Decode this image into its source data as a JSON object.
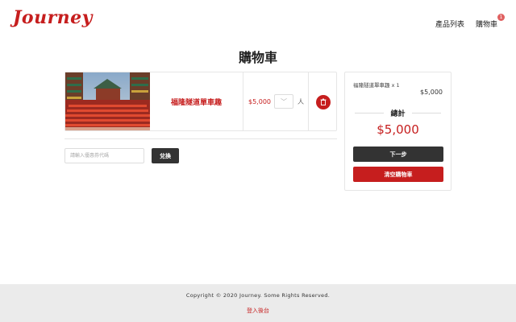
{
  "header": {
    "logo": "Journey",
    "nav": {
      "products": "產品列表",
      "cart": "購物車"
    },
    "cart_badge": "1"
  },
  "page": {
    "title": "購物車"
  },
  "cart_item": {
    "name": "福隆隧道單車趣",
    "price": "$5,000",
    "unit": "人"
  },
  "coupon": {
    "placeholder": "請輸入優惠券代碼",
    "apply_label": "兌換"
  },
  "summary": {
    "line_item": "福隆隧道單車趣 x 1",
    "line_price": "$5,000",
    "total_label": "總計",
    "total_value": "$5,000",
    "next_label": "下一步",
    "clear_label": "清空購物車"
  },
  "footer": {
    "copyright": "Copyright © 2020 Journey. Some Rights Reserved.",
    "admin_link": "登入後台"
  },
  "colors": {
    "brand": "#c61e1e",
    "dark_button": "#333333",
    "footer_bg": "#ebebeb"
  }
}
